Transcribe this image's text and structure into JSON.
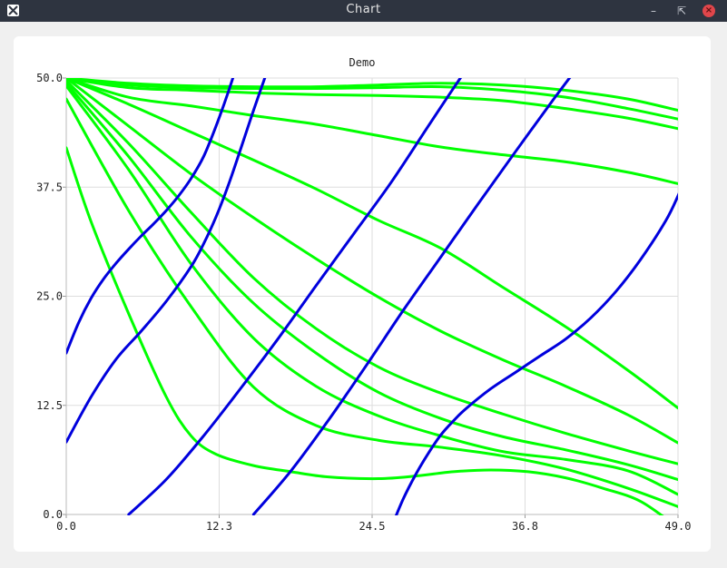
{
  "window": {
    "title": "Chart"
  },
  "chart_data": {
    "type": "line",
    "title": "Demo",
    "xlabel": "",
    "ylabel": "",
    "xlim": [
      0,
      49
    ],
    "ylim": [
      0,
      50
    ],
    "xticks": [
      "0.0",
      "12.3",
      "24.5",
      "36.8",
      "49.0"
    ],
    "yticks": [
      "0.0",
      "12.5",
      "25.0",
      "37.5",
      "50.0"
    ],
    "grid": true,
    "colors": {
      "green": "#00ff00",
      "blue": "#0000dd",
      "grid": "#dddddd"
    },
    "series": [
      {
        "color": "green",
        "x": [
          0,
          5,
          10,
          15,
          20,
          25,
          30,
          35,
          40,
          45,
          49
        ],
        "y": [
          50,
          49.4,
          49.1,
          49.0,
          49.0,
          49.2,
          49.4,
          49.2,
          48.6,
          47.6,
          46.3
        ]
      },
      {
        "color": "green",
        "x": [
          0,
          5,
          10,
          15,
          20,
          25,
          30,
          35,
          40,
          45,
          49
        ],
        "y": [
          50,
          49.2,
          48.9,
          48.8,
          48.8,
          48.9,
          49.0,
          48.6,
          47.8,
          46.5,
          45.3
        ]
      },
      {
        "color": "green",
        "x": [
          0,
          5,
          10,
          15,
          20,
          25,
          30,
          35,
          40,
          45,
          49
        ],
        "y": [
          50,
          48.9,
          48.6,
          48.3,
          48.1,
          48.0,
          47.8,
          47.4,
          46.5,
          45.4,
          44.2
        ]
      },
      {
        "color": "green",
        "x": [
          0,
          5,
          10,
          15,
          20,
          25,
          30,
          35,
          40,
          45,
          49
        ],
        "y": [
          50,
          47.8,
          46.8,
          45.7,
          44.7,
          43.4,
          42.1,
          41.2,
          40.4,
          39.2,
          37.9
        ]
      },
      {
        "color": "green",
        "x": [
          0,
          5,
          10,
          15,
          20,
          25,
          30,
          35,
          40,
          45,
          49
        ],
        "y": [
          50,
          47.0,
          43.8,
          40.6,
          37.3,
          33.7,
          30.5,
          26.0,
          21.5,
          16.5,
          12.2
        ]
      },
      {
        "color": "green",
        "x": [
          0,
          5,
          10,
          15,
          20,
          25,
          30,
          35,
          40,
          45,
          49
        ],
        "y": [
          50,
          44.5,
          39.0,
          34.0,
          29.3,
          24.9,
          21.0,
          17.7,
          14.7,
          11.4,
          8.2
        ]
      },
      {
        "color": "green",
        "x": [
          0,
          5,
          10,
          15,
          20,
          25,
          30,
          35,
          40,
          45,
          49
        ],
        "y": [
          49.7,
          42.5,
          34.6,
          27.1,
          21.3,
          16.9,
          13.9,
          11.5,
          9.3,
          7.3,
          5.8
        ]
      },
      {
        "color": "green",
        "x": [
          0,
          5,
          10,
          15,
          20,
          25,
          30,
          35,
          40,
          45,
          49
        ],
        "y": [
          49.4,
          41.0,
          31.8,
          24.2,
          18.5,
          14.0,
          11.0,
          8.9,
          7.4,
          5.7,
          4.0
        ]
      },
      {
        "color": "green",
        "x": [
          0,
          5,
          10,
          15,
          20,
          25,
          30,
          35,
          40,
          45,
          49
        ],
        "y": [
          49.1,
          39.5,
          28.7,
          20.2,
          14.7,
          11.3,
          9.0,
          7.2,
          6.3,
          5.0,
          2.3
        ]
      },
      {
        "color": "green",
        "x": [
          0,
          5,
          10,
          15,
          20,
          25,
          30,
          35,
          40,
          45,
          49
        ],
        "y": [
          47.6,
          34.8,
          23.8,
          14.6,
          10.2,
          8.5,
          7.7,
          6.7,
          5.2,
          3.0,
          0.9
        ]
      },
      {
        "color": "green",
        "x": [
          0,
          2,
          5,
          8,
          10,
          12,
          15,
          18,
          21,
          25,
          28,
          31,
          34,
          37,
          40,
          43,
          46,
          49
        ],
        "y": [
          42.0,
          33.5,
          23.0,
          13.5,
          9.0,
          6.9,
          5.6,
          4.9,
          4.3,
          4.1,
          4.4,
          4.9,
          5.1,
          4.9,
          4.2,
          3.0,
          1.5,
          -1.5
        ]
      },
      {
        "color": "blue",
        "x": [
          0,
          1,
          2,
          3,
          4,
          5,
          6,
          7,
          8,
          9,
          10,
          11,
          12,
          13,
          14,
          15
        ],
        "y": [
          18.5,
          22.0,
          24.8,
          27.0,
          28.8,
          30.4,
          31.9,
          33.3,
          34.8,
          36.5,
          38.5,
          41.0,
          44.5,
          48.5,
          53.0,
          58.0
        ]
      },
      {
        "color": "blue",
        "x": [
          0,
          2,
          4,
          6,
          8,
          10,
          11,
          12,
          13,
          14,
          15,
          16,
          17
        ],
        "y": [
          8.3,
          13.5,
          17.8,
          21.0,
          24.4,
          28.4,
          31.0,
          34.1,
          37.8,
          42.0,
          46.3,
          50.4,
          54.5
        ]
      },
      {
        "color": "blue",
        "x": [
          5,
          8,
          11,
          14,
          17,
          20,
          23,
          26,
          29,
          31,
          33
        ],
        "y": [
          0,
          4.0,
          9.0,
          14.5,
          20.2,
          26.2,
          32.1,
          38.0,
          44.5,
          48.8,
          53.0
        ]
      },
      {
        "color": "blue",
        "x": [
          15,
          18,
          21,
          24,
          27,
          30,
          33,
          36,
          39,
          41,
          43
        ],
        "y": [
          0,
          5.0,
          10.8,
          17.0,
          23.4,
          29.5,
          35.6,
          41.6,
          47.5,
          51.3,
          55.0
        ]
      },
      {
        "color": "blue",
        "x": [
          25,
          26,
          27,
          28,
          29,
          30,
          31,
          32,
          34,
          36,
          38,
          40,
          42,
          44,
          46,
          48,
          49,
          50
        ],
        "y": [
          -5.0,
          -1.6,
          1.8,
          4.6,
          7.0,
          9.1,
          10.7,
          12.1,
          14.4,
          16.3,
          18.2,
          20.1,
          22.5,
          25.5,
          29.2,
          33.6,
          36.5,
          40.0
        ]
      }
    ]
  }
}
